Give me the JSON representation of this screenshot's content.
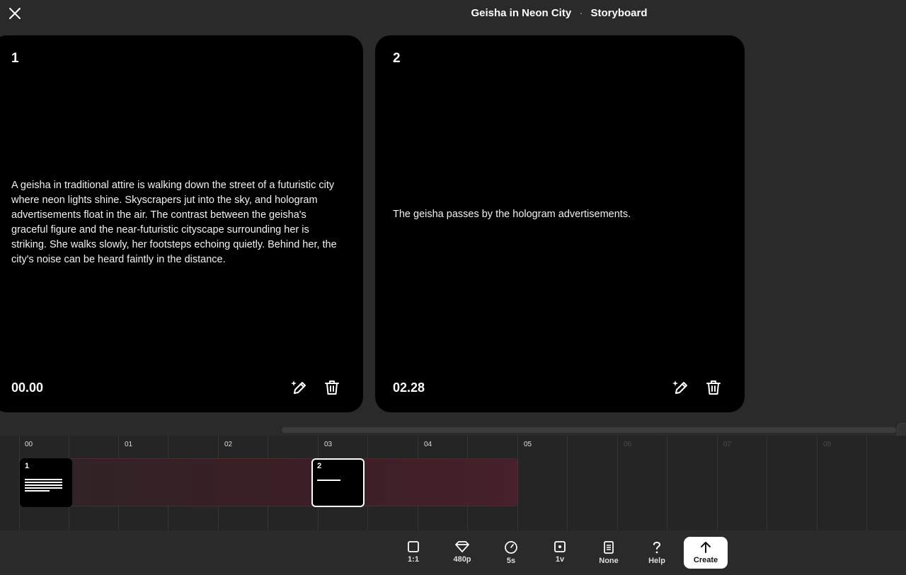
{
  "header": {
    "project_title": "Geisha in Neon City",
    "separator": "·",
    "view_name": "Storyboard"
  },
  "cards": [
    {
      "number": "1",
      "description": "A geisha in traditional attire is walking down the street of a futuristic city where neon lights shine. Skyscrapers jut into the sky, and hologram advertisements float in the air. The contrast between the geisha's graceful figure and the near-futuristic cityscape surrounding her is striking. She walks slowly, her footsteps echoing quietly. Behind her, the city's noise can be heard faintly in the distance.",
      "timestamp": "00.00"
    },
    {
      "number": "2",
      "description": "The geisha passes by the hologram advertisements.",
      "timestamp": "02.28"
    }
  ],
  "timeline": {
    "labels": [
      "00",
      "01",
      "02",
      "03",
      "04",
      "05",
      "06",
      "07",
      "08"
    ],
    "shots": [
      {
        "number": "1"
      },
      {
        "number": "2"
      }
    ]
  },
  "toolbar": {
    "aspect_ratio": "1:1",
    "resolution": "480p",
    "duration": "5s",
    "variations": "1v",
    "preset": "None",
    "help": "Help",
    "create": "Create"
  },
  "colors": {
    "background": "#2a2a2a",
    "card": "#000000",
    "clip_band": "#46202a"
  }
}
